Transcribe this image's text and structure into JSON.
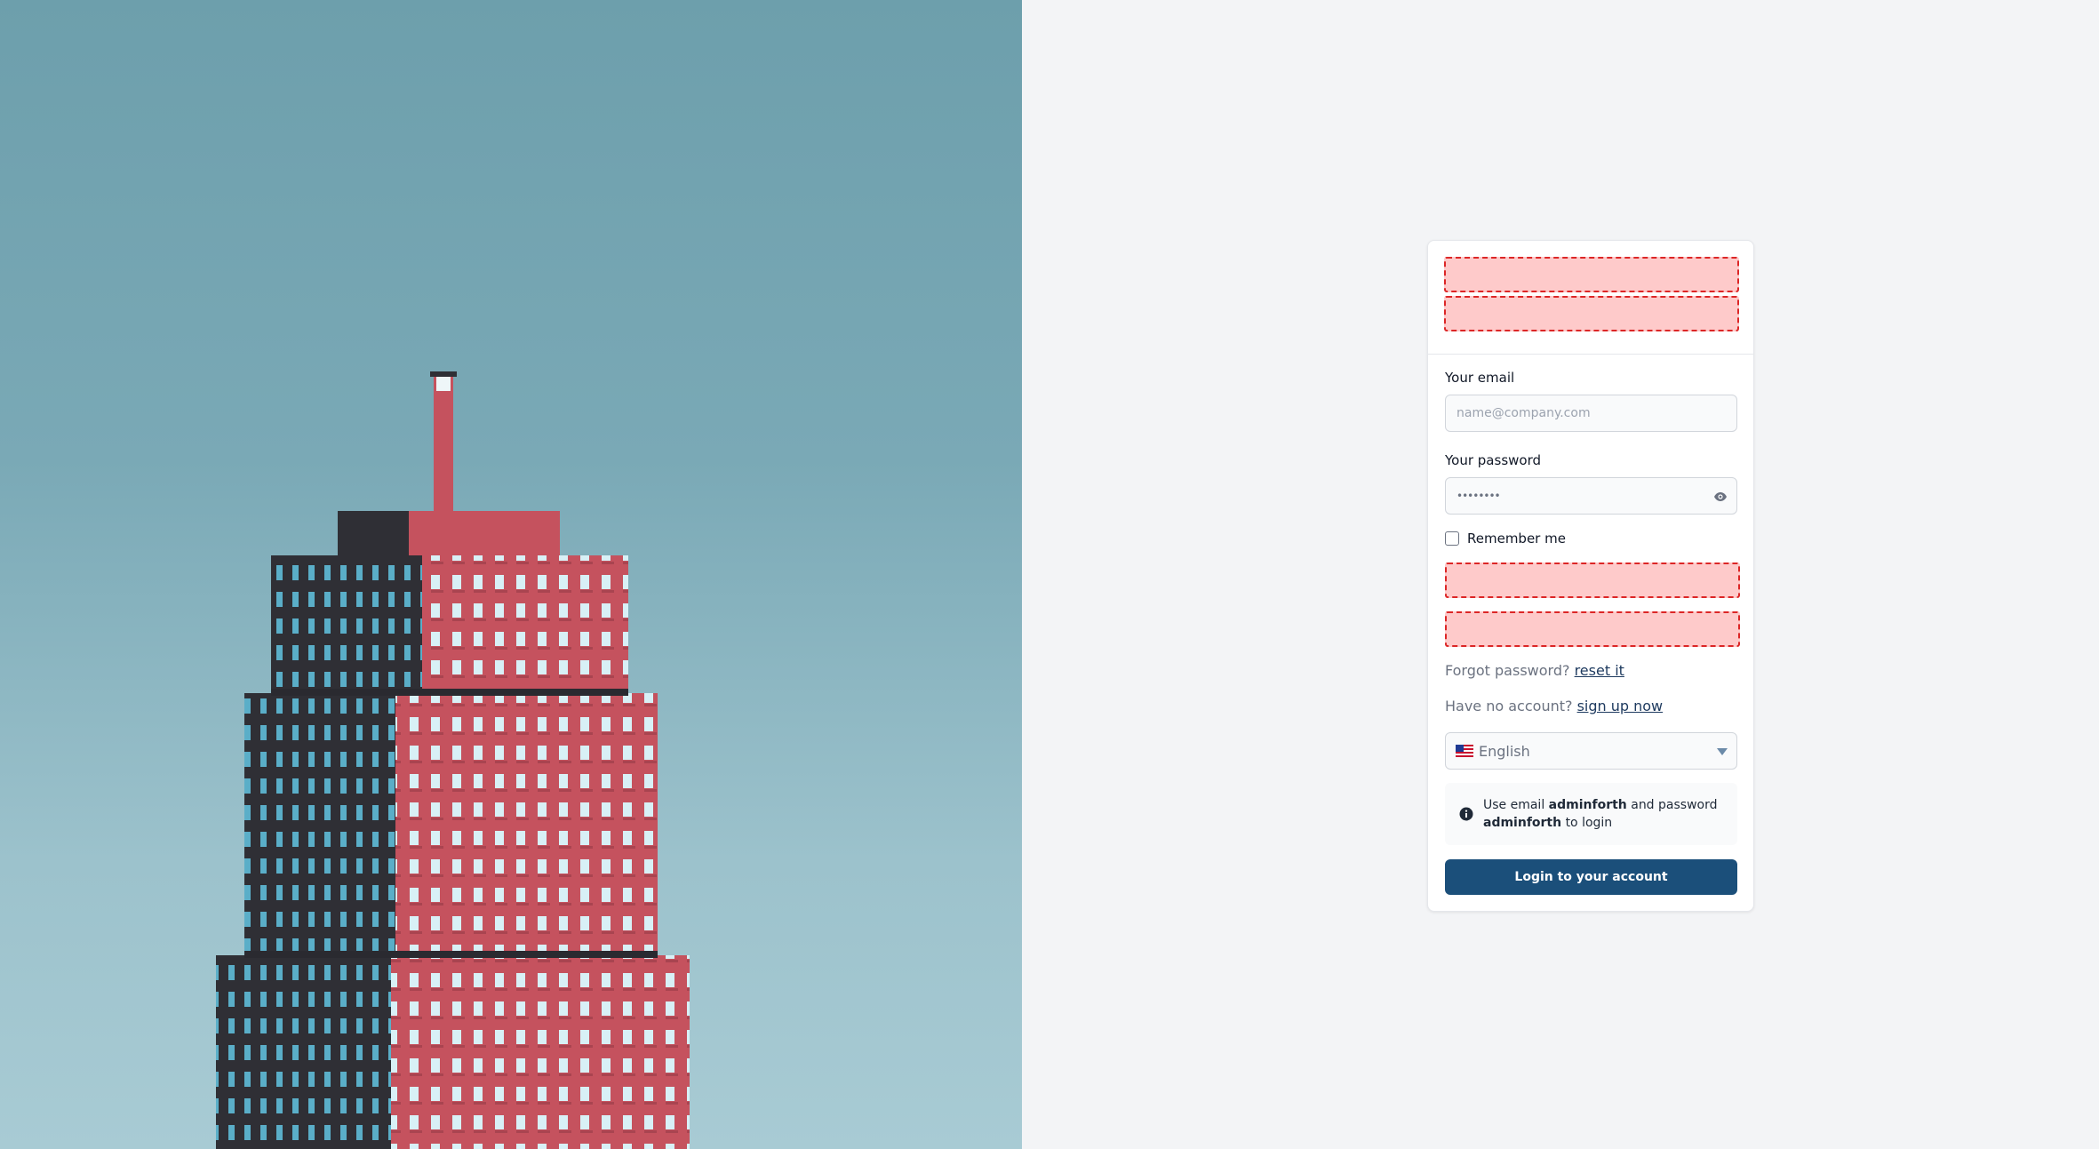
{
  "hero": {
    "image": "red-brick-tower-against-blue-sky"
  },
  "login": {
    "email_label": "Your email",
    "email_placeholder": "name@company.com",
    "email_value": "",
    "password_label": "Your password",
    "password_value": "••••••••",
    "remember_label": "Remember me",
    "remember_checked": false,
    "forgot_text": "Forgot password?",
    "forgot_link": "reset it",
    "noacct_text": "Have no account?",
    "noacct_link": "sign up now",
    "language": "English",
    "info": {
      "prefix": "Use email",
      "email": "adminforth",
      "middle": "and password",
      "password": "adminforth",
      "suffix": "to login"
    },
    "submit_label": "Login to your account"
  },
  "icons": {
    "password_toggle": "eye-icon",
    "info": "info-circle-icon",
    "language_flag": "us-flag-icon",
    "dropdown": "chevron-down-icon"
  },
  "colors": {
    "primary": "#1b4f7a",
    "link": "#1e3a5f",
    "placeholder_fill": "#fecaca",
    "placeholder_border": "#dc2626"
  }
}
